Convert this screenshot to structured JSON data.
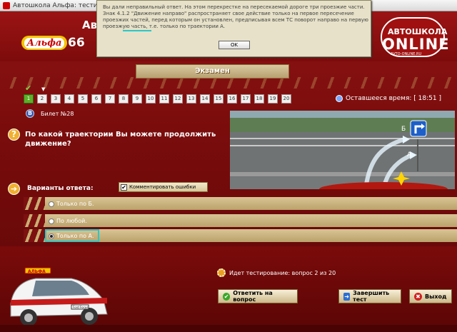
{
  "window": {
    "title": "Автошкола Альфа: тестирование"
  },
  "banner": {
    "logo_text": "Альфа",
    "phone_fragment": "66",
    "title_fragment": "Ав",
    "online_top": "АВТОШКОЛА",
    "online_word": "ONLINE",
    "online_site": "AVTO-ONLINE.RU"
  },
  "dialog": {
    "message": "Вы дали неправильный ответ. На этом перекрестке на пересекаемой дороге три проезжие части. Знак 4.1.2 \"Движение направо\" распространяет свое действие только на первое пересечение проезжих частей, перед которым он установлен, предписывая всем ТС поворот направо на первую проезжую часть, т.е. только по траектории А.",
    "ok_label": "OK"
  },
  "exam": {
    "header": "Экзамен"
  },
  "questions": [
    "1",
    "2",
    "3",
    "4",
    "5",
    "6",
    "7",
    "8",
    "9",
    "10",
    "11",
    "12",
    "13",
    "14",
    "15",
    "16",
    "17",
    "18",
    "19",
    "20"
  ],
  "timer": {
    "label": "Оставшееся время: [ 18:51 ]"
  },
  "ticket": {
    "label": "Билет №28",
    "icon": "B"
  },
  "question": {
    "text": "По какой траектории Вы можете продолжить движение?"
  },
  "scene": {
    "label_b": "Б",
    "label_a": "А"
  },
  "options": {
    "label": "Варианты ответа:",
    "comment_label": "Комментировать ошибки",
    "answers": [
      "Только по Б.",
      "По любой.",
      "Только по А."
    ]
  },
  "status": {
    "text": "Идет тестирование: вопрос 2 из 20"
  },
  "buttons": {
    "answer": "Ответить на вопрос",
    "finish": "Завершить тест",
    "exit": "Выход"
  },
  "car": {
    "roof_sign": "АЛЬФА",
    "plate": "Ford Focus"
  },
  "colors": {
    "accent": "#29c7c7",
    "background": "#7a0c0c",
    "panel": "#d8c494"
  }
}
